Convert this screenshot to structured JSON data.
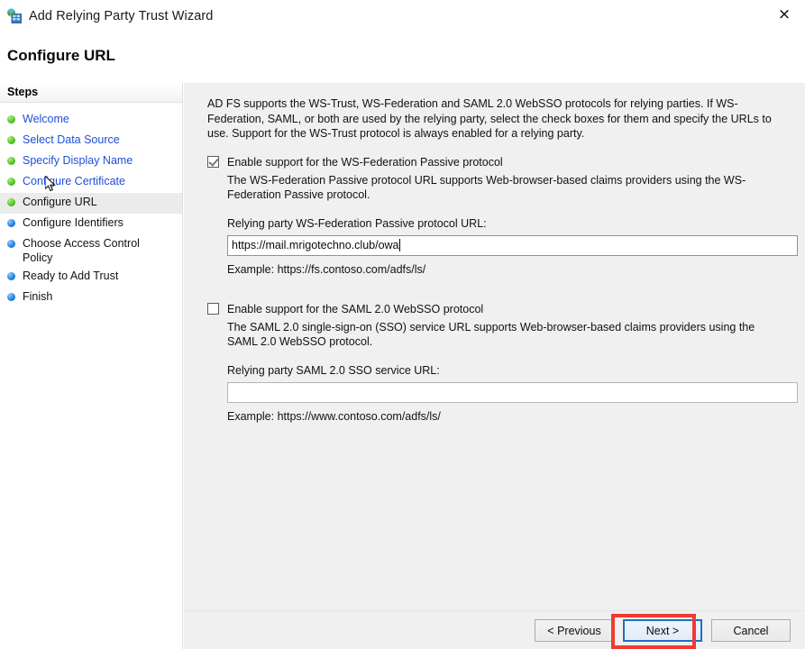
{
  "window": {
    "title": "Add Relying Party Trust Wizard",
    "icon": "network-window-icon",
    "close_label": "×"
  },
  "page": {
    "header": "Configure URL"
  },
  "sidebar": {
    "heading": "Steps",
    "items": [
      {
        "label": "Welcome",
        "state": "done",
        "bullet": "green"
      },
      {
        "label": "Select Data Source",
        "state": "done",
        "bullet": "green"
      },
      {
        "label": "Specify Display Name",
        "state": "done",
        "bullet": "green"
      },
      {
        "label": "Configure Certificate",
        "state": "done",
        "bullet": "green"
      },
      {
        "label": "Configure URL",
        "state": "current",
        "bullet": "green"
      },
      {
        "label": "Configure Identifiers",
        "state": "pending",
        "bullet": "blue"
      },
      {
        "label": "Choose Access Control Policy",
        "state": "pending",
        "bullet": "blue"
      },
      {
        "label": "Ready to Add Trust",
        "state": "pending",
        "bullet": "blue"
      },
      {
        "label": "Finish",
        "state": "pending",
        "bullet": "blue"
      }
    ]
  },
  "main": {
    "intro": "AD FS supports the WS-Trust, WS-Federation and SAML 2.0 WebSSO protocols for relying parties.  If WS-Federation, SAML, or both are used by the relying party, select the check boxes for them and specify the URLs to use.  Support for the WS-Trust protocol is always enabled for a relying party.",
    "wsfed": {
      "checkbox_label": "Enable support for the WS-Federation Passive protocol",
      "checked": true,
      "description": "The WS-Federation Passive protocol URL supports Web-browser-based claims providers using the WS-Federation Passive protocol.",
      "field_label": "Relying party WS-Federation Passive protocol URL:",
      "value": "https://mail.mrigotechno.club/owa",
      "placeholder": "",
      "example": "Example: https://fs.contoso.com/adfs/ls/"
    },
    "saml": {
      "checkbox_label": "Enable support for the SAML 2.0 WebSSO protocol",
      "checked": false,
      "description": "The SAML 2.0 single-sign-on (SSO) service URL supports Web-browser-based claims providers using the SAML 2.0 WebSSO protocol.",
      "field_label": "Relying party SAML 2.0 SSO service URL:",
      "value": "",
      "placeholder": "",
      "example": "Example: https://www.contoso.com/adfs/ls/"
    }
  },
  "footer": {
    "previous_label": "< Previous",
    "next_label": "Next >",
    "cancel_label": "Cancel"
  },
  "colors": {
    "link": "#1f4fd8",
    "panel_bg": "#f0f0f0",
    "focus_border": "#1e6fc4",
    "annotation": "#f03a31",
    "bullet_green": "#5cc72a",
    "bullet_blue": "#2a86e0"
  }
}
